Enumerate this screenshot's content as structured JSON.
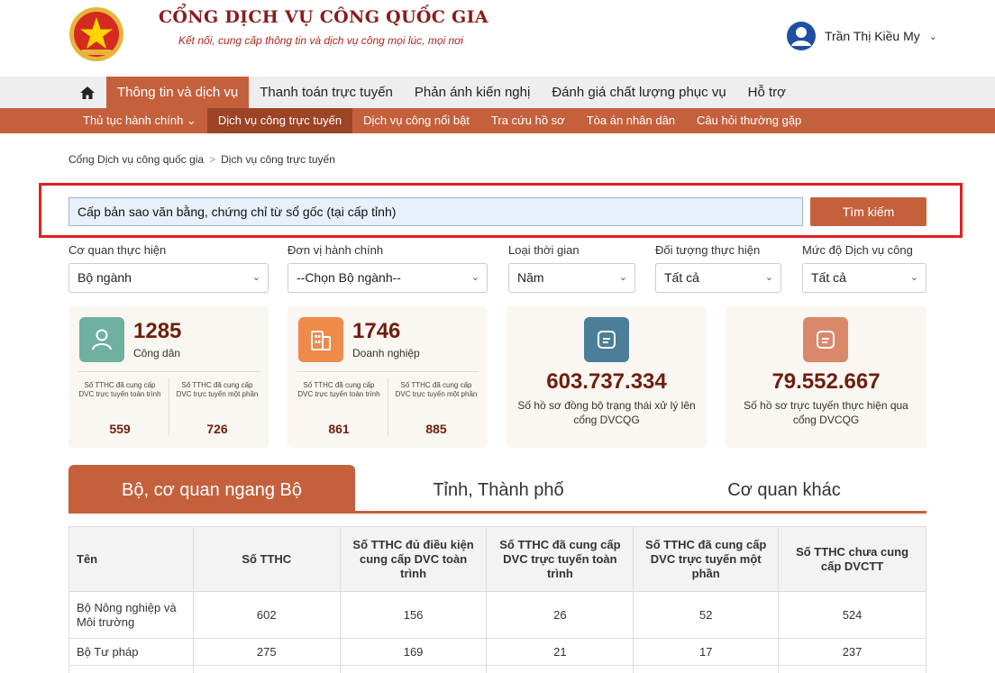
{
  "header": {
    "title": "CỔNG DỊCH VỤ CÔNG QUỐC GIA",
    "subtitle": "Kết nối, cung cấp thông tin và dịch vụ công mọi lúc, mọi nơi",
    "user_name": "Trần Thị Kiều My"
  },
  "main_nav": {
    "items": [
      "Thông tin và dịch vụ",
      "Thanh toán trực tuyến",
      "Phản ánh kiến nghị",
      "Đánh giá chất lượng phục vụ",
      "Hỗ trợ"
    ]
  },
  "sub_nav": {
    "items": [
      "Thủ tục hành chính ⌄",
      "Dịch vụ công trực tuyến",
      "Dịch vụ công nổi bật",
      "Tra cứu hồ sơ",
      "Tòa án nhân dân",
      "Câu hỏi thường gặp"
    ]
  },
  "breadcrumb": {
    "home": "Cổng Dịch vụ công quốc gia",
    "sep": ">",
    "current": "Dịch vụ công trực tuyến"
  },
  "search": {
    "value": "Cấp bản sao văn bằng, chứng chỉ từ sổ gốc (tại cấp tỉnh)",
    "button": "Tìm kiếm"
  },
  "filters": [
    {
      "label": "Cơ quan thực hiện",
      "value": "Bộ ngành"
    },
    {
      "label": "Đơn vị hành chính",
      "value": "--Chọn Bộ ngành--"
    },
    {
      "label": "Loại thời gian",
      "value": "Năm"
    },
    {
      "label": "Đối tượng thực hiện",
      "value": "Tất cả"
    },
    {
      "label": "Mức độ Dịch vụ công",
      "value": "Tất cả"
    }
  ],
  "stats": {
    "citizen": {
      "count": "1285",
      "label": "Công dân",
      "left_label": "Số TTHC đã cung cấp DVC trực tuyến toàn trình",
      "left_value": "559",
      "right_label": "Số TTHC đã cung cấp DVC trực tuyến một phần",
      "right_value": "726"
    },
    "business": {
      "count": "1746",
      "label": "Doanh nghiệp",
      "left_label": "Số TTHC đã cung cấp DVC trực tuyến toàn trình",
      "left_value": "861",
      "right_label": "Số TTHC đã cung cấp DVC trực tuyến một phần",
      "right_value": "885"
    },
    "synced": {
      "value": "603.737.334",
      "label": "Số hồ sơ đồng bộ trạng thái xử lý lên cổng DVCQG"
    },
    "online": {
      "value": "79.552.667",
      "label": "Số hồ sơ trực tuyến thực hiện qua cổng DVCQG"
    }
  },
  "tabs": [
    "Bộ, cơ quan ngang Bộ",
    "Tỉnh, Thành phố",
    "Cơ quan khác"
  ],
  "table": {
    "headers": [
      "Tên",
      "Số TTHC",
      "Số TTHC đủ điều kiện cung cấp DVC toàn trình",
      "Số TTHC đã cung cấp DVC trực tuyến toàn trình",
      "Số TTHC đã cung cấp DVC trực tuyến một phần",
      "Số TTHC chưa cung cấp DVCTT"
    ],
    "rows": [
      [
        "Bộ Nông nghiệp và Môi trường",
        "602",
        "156",
        "26",
        "52",
        "524"
      ],
      [
        "Bộ Tư pháp",
        "275",
        "169",
        "21",
        "17",
        "237"
      ]
    ]
  },
  "colors": {
    "accent": "#c5603d",
    "accent_dark": "#9d4326",
    "number": "#6e1e0e",
    "highlight_border": "#e02020",
    "citizen_icon": "#6fb0a0",
    "business_icon": "#ee8a4a",
    "synced_icon": "#4b7f99",
    "online_icon": "#d9896a"
  }
}
